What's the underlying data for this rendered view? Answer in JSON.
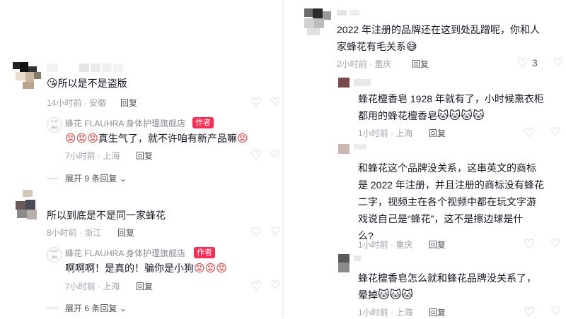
{
  "icons": {
    "heart": "♡",
    "broken_heart": "♡",
    "angry_emoji": "😡",
    "kiss_emoji": "😘",
    "grin_emoji": "😅",
    "fox_emoji": "🐱"
  },
  "left": {
    "c1": {
      "text": "所以是不是盗版",
      "time": "14小时前 · 安徽",
      "reply": "回复"
    },
    "r1": {
      "store_name": "蜂花 FLAUHRA 身体护理旗舰店",
      "badge": "作者",
      "text": "真生气了，就不许咱有新产品嘛",
      "time": "7小时前 · 上海",
      "reply": "回复"
    },
    "expand1": "展开 9 条回复",
    "c2": {
      "text": "所以到底是不是同一家蜂花",
      "time": "8小时前 · 浙江",
      "reply": "回复"
    },
    "r2": {
      "store_name": "蜂花 FLAUHRA 身体护理旗舰店",
      "badge": "作者",
      "text_a": "啊啊啊！是真的！骗你是小狗",
      "time": "7小时前 · 上海",
      "reply": "回复"
    },
    "expand2": "展开 6 条回复"
  },
  "right": {
    "c1": {
      "text_line1": "2022 年注册的品牌还在这到处乱蹭呢，你和人",
      "text_line2": "家蜂花有毛关系",
      "time": "2小时前 · 重庆",
      "reply": "回复",
      "likes": "3"
    },
    "c2": {
      "text_line1": "蜂花檀香皂 1928 年就有了，小时候熏衣柜",
      "text_line2": "都用的蜂花檀香皂",
      "time": "1小时前 · 上海",
      "reply": "回复"
    },
    "c3": {
      "lines": [
        "和蜂花这个品牌没关系，这串英文的商标",
        "是 2022 年注册，并且注册的商标没有蜂花",
        "二字，视频主在各个视频中都在玩文字游",
        "戏说自己是“蜂花”，这不是擦边球是什",
        "么?"
      ],
      "time": "1小时前 · 重庆",
      "reply": "回复"
    },
    "c4": {
      "text_line1": "蜂花檀香皂怎么就和蜂花品牌没关系了，",
      "text_line2": "晕掉",
      "time": "1小时前 · 上海",
      "reply": "回复"
    }
  },
  "colors": {
    "badge": "#fe2c55",
    "text": "#161823",
    "meta": "#a0a0a8"
  }
}
